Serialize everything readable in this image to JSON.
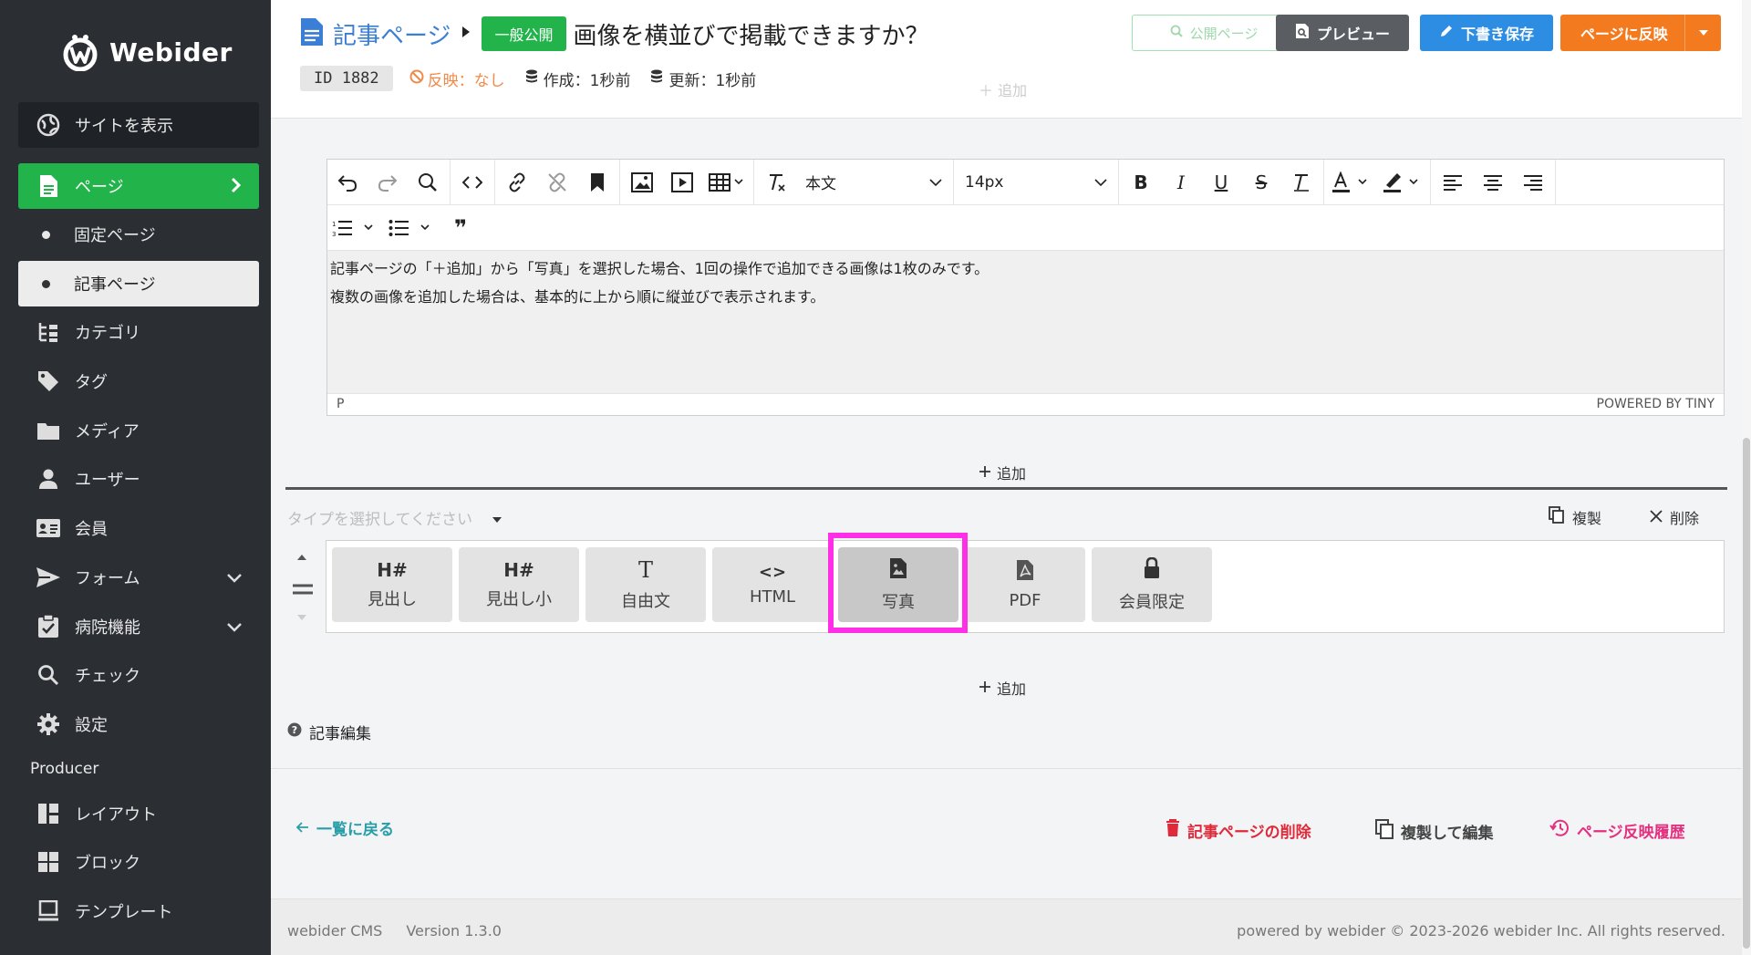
{
  "sidebar": {
    "logo_text": "Webider",
    "view_site": "サイトを表示",
    "items": [
      {
        "label": "ページ",
        "icon": "page-icon"
      },
      {
        "label": "固定ページ"
      },
      {
        "label": "記事ページ"
      },
      {
        "label": "カテゴリ",
        "icon": "category-icon"
      },
      {
        "label": "タグ",
        "icon": "tag-icon"
      },
      {
        "label": "メディア",
        "icon": "folder-icon"
      },
      {
        "label": "ユーザー",
        "icon": "user-icon"
      },
      {
        "label": "会員",
        "icon": "member-card-icon"
      },
      {
        "label": "フォーム",
        "icon": "send-icon"
      },
      {
        "label": "病院機能",
        "icon": "clipboard-check-icon"
      },
      {
        "label": "チェック",
        "icon": "search-icon"
      },
      {
        "label": "設定",
        "icon": "gear-icon"
      }
    ],
    "producer_heading": "Producer",
    "producer_items": [
      {
        "label": "レイアウト",
        "icon": "layout-icon"
      },
      {
        "label": "ブロック",
        "icon": "grid-icon"
      },
      {
        "label": "テンプレート",
        "icon": "monitor-icon"
      }
    ],
    "colors": {
      "bg": "#2b2e33",
      "active": "#22b34b"
    }
  },
  "header": {
    "breadcrumb": "記事ページ",
    "status": "一般公開",
    "title": "画像を横並びで掲載できますか？",
    "id_label": "ID 1882",
    "reflect_status": "反映：なし",
    "created": "作成：1秒前",
    "updated": "更新：1秒前",
    "buttons": {
      "public": "公開ページ",
      "preview": "プレビュー",
      "draft": "下書き保存",
      "reflect": "ページに反映"
    },
    "ghost_add": "追加"
  },
  "editor": {
    "style_select": "本文",
    "size_select": "14px",
    "content_lines": [
      "記事ページの「＋追加」から「写真」を選択した場合、1回の操作で追加できる画像は1枚のみです。",
      "複数の画像を追加した場合は、基本的に上から順に縦並びで表示されます。"
    ],
    "status_path": "P",
    "powered": "POWERED BY TINY"
  },
  "block": {
    "add_label": "追加",
    "type_placeholder": "タイプを選択してください",
    "duplicate": "複製",
    "delete": "削除",
    "types": [
      {
        "icon": "H#",
        "label": "見出し"
      },
      {
        "icon": "H#",
        "label": "見出し小"
      },
      {
        "icon": "T",
        "label": "自由文"
      },
      {
        "icon": "<>",
        "label": "HTML"
      },
      {
        "icon": "photo-icon",
        "label": "写真"
      },
      {
        "icon": "pdf-icon",
        "label": "PDF"
      },
      {
        "icon": "lock-icon",
        "label": "会員限定"
      }
    ],
    "highlight_color": "#ff2fe8"
  },
  "bottom": {
    "add_label": "追加",
    "help": "記事編集",
    "back": "一覧に戻る",
    "delete_page": "記事ページの削除",
    "duplicate_edit": "複製して編集",
    "history": "ページ反映履歴"
  },
  "footer": {
    "cms": "webider CMS",
    "version": "Version 1.3.0",
    "copyright": "powered by webider © 2023-2026 webider Inc. All rights reserved."
  }
}
